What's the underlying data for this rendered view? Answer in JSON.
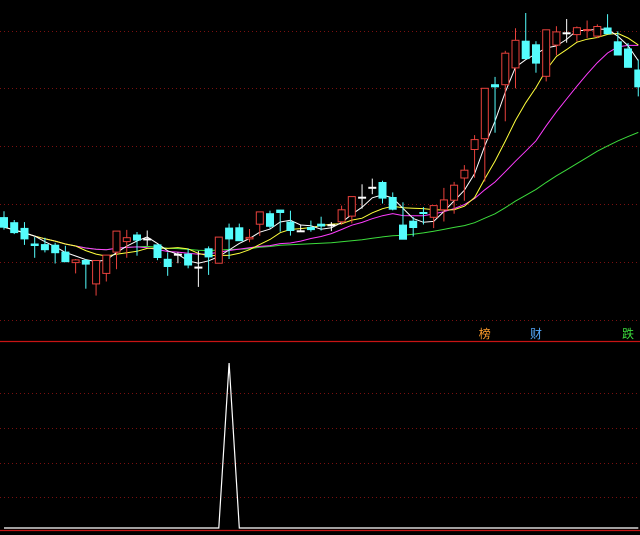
{
  "colors": {
    "background": "#000000",
    "grid": "#7a1010",
    "separator": "#c81414",
    "up_candle": "#e8413c",
    "down_candle": "#54fcfc",
    "flat_candle": "#ffffff",
    "ma_white": "#ffffff",
    "ma_yellow": "#ffff3c",
    "ma_magenta": "#ff3cff",
    "ma_green": "#3cdc3c",
    "indicator_line": "#ffffff"
  },
  "markers": [
    {
      "label": "榜",
      "candle_index": 47,
      "color": "#ff9c2c"
    },
    {
      "label": "财",
      "candle_index": 52,
      "color": "#54a8fc"
    },
    {
      "label": "跌",
      "candle_index": 61,
      "color": "#3cdc3c"
    }
  ],
  "chart_data": [
    {
      "type": "candlestick",
      "title": "",
      "xlabel": "",
      "ylabel": "",
      "grid": true,
      "ylim": [
        0,
        100
      ],
      "x": [
        0,
        1,
        2,
        3,
        4,
        5,
        6,
        7,
        8,
        9,
        10,
        11,
        12,
        13,
        14,
        15,
        16,
        17,
        18,
        19,
        20,
        21,
        22,
        23,
        24,
        25,
        26,
        27,
        28,
        29,
        30,
        31,
        32,
        33,
        34,
        35,
        36,
        37,
        38,
        39,
        40,
        41,
        42,
        43,
        44,
        45,
        46,
        47,
        48,
        49,
        50,
        51,
        52,
        53,
        54,
        55,
        56,
        57,
        58,
        59,
        60,
        61,
        62
      ],
      "open": [
        30.8,
        29.1,
        27.2,
        22.0,
        21.8,
        21.6,
        19.3,
        15.8,
        16.5,
        8.7,
        12.2,
        19.3,
        22.8,
        25.0,
        23.6,
        21.7,
        16.9,
        18.6,
        18.6,
        14.3,
        20.4,
        15.6,
        27.3,
        27.4,
        23.7,
        28.6,
        32.1,
        33.3,
        29.3,
        26.4,
        27.5,
        28.6,
        28.3,
        29.4,
        31.3,
        37.6,
        40.8,
        42.5,
        37.5,
        28.3,
        29.6,
        32.5,
        30.9,
        33.4,
        36.6,
        44.0,
        53.5,
        57.1,
        75.1,
        75.1,
        80.7,
        89.6,
        88.4,
        77.9,
        88.3,
        92.4,
        91.8,
        93.3,
        91.3,
        94.0,
        89.4,
        87.0,
        80.0
      ],
      "high": [
        32.9,
        30.0,
        29.3,
        24.3,
        24.1,
        22.4,
        21.4,
        17.0,
        17.0,
        15.5,
        17.0,
        21.3,
        26.7,
        26.0,
        26.5,
        21.9,
        19.2,
        19.2,
        20.5,
        19.7,
        21.2,
        23.8,
        28.8,
        28.8,
        27.0,
        32.1,
        33.1,
        33.1,
        33.1,
        28.5,
        29.8,
        31.1,
        29.3,
        34.8,
        34.8,
        41.9,
        43.8,
        43.1,
        39.2,
        35.9,
        31.0,
        34.3,
        34.1,
        40.7,
        42.7,
        48.3,
        58.3,
        69.6,
        77.7,
        86.4,
        93.9,
        99.0,
        89.6,
        93.1,
        94.6,
        97.0,
        94.5,
        96.5,
        95.2,
        98.6,
        92.9,
        89.0,
        83.5
      ],
      "low": [
        26.8,
        25.3,
        21.7,
        17.4,
        19.2,
        15.5,
        16.6,
        12.2,
        7.1,
        4.8,
        9.5,
        13.6,
        17.4,
        18.1,
        21.4,
        16.6,
        11.4,
        15.6,
        13.9,
        7.7,
        11.7,
        16.9,
        17.0,
        24.1,
        22.6,
        24.7,
        27.2,
        26.1,
        24.8,
        26.4,
        26.1,
        26.5,
        26.3,
        28.4,
        28.9,
        33.8,
        38.6,
        35.5,
        33.2,
        24.7,
        24.5,
        28.5,
        27.3,
        29.5,
        32.1,
        36.4,
        44.1,
        42.8,
        59.1,
        62.9,
        73.9,
        86.4,
        79.1,
        76.2,
        84.9,
        89.1,
        89.5,
        90.7,
        90.6,
        92.7,
        86.0,
        82.6,
        71.2
      ],
      "close": [
        27.6,
        25.8,
        23.7,
        21.5,
        20.1,
        19.1,
        16.1,
        16.7,
        15.3,
        16.5,
        18.3,
        26.3,
        24.1,
        23.3,
        23.7,
        17.5,
        14.5,
        18.6,
        15.0,
        14.3,
        17.7,
        24.3,
        23.7,
        23.1,
        24.2,
        32.7,
        27.9,
        32.5,
        26.5,
        26.4,
        26.8,
        28.0,
        28.4,
        33.4,
        37.8,
        37.5,
        40.9,
        37.3,
        33.6,
        23.6,
        27.5,
        32.3,
        34.8,
        36.7,
        41.6,
        46.6,
        56.8,
        73.9,
        74.4,
        85.6,
        89.9,
        83.8,
        82.3,
        93.4,
        92.7,
        92.4,
        94.1,
        93.5,
        94.5,
        92.1,
        85.0,
        80.9,
        74.4
      ]
    },
    {
      "type": "line",
      "title": "",
      "ylim": [
        0,
        100
      ],
      "x": [
        0,
        1,
        2,
        3,
        4,
        5,
        6,
        7,
        8,
        9,
        10,
        11,
        12,
        13,
        14,
        15,
        16,
        17,
        18,
        19,
        20,
        21,
        22,
        23,
        24,
        25,
        26,
        27,
        28,
        29,
        30,
        31,
        32,
        33,
        34,
        35,
        36,
        37,
        38,
        39,
        40,
        41,
        42,
        43,
        44,
        45,
        46,
        47,
        48,
        49,
        50,
        51,
        52,
        53,
        54,
        55,
        56,
        57,
        58,
        59,
        60,
        61,
        62
      ],
      "values": [
        0,
        0,
        0,
        0,
        0,
        0,
        0,
        0,
        0,
        0,
        0,
        0,
        0,
        0,
        0,
        0,
        0,
        0,
        0,
        0,
        0,
        0,
        100,
        0,
        0,
        0,
        0,
        0,
        0,
        0,
        0,
        0,
        0,
        0,
        0,
        0,
        0,
        0,
        0,
        0,
        0,
        0,
        0,
        0,
        0,
        0,
        0,
        0,
        0,
        0,
        0,
        0,
        0,
        0,
        0,
        0,
        0,
        0,
        0,
        0,
        0,
        0,
        0
      ]
    }
  ]
}
